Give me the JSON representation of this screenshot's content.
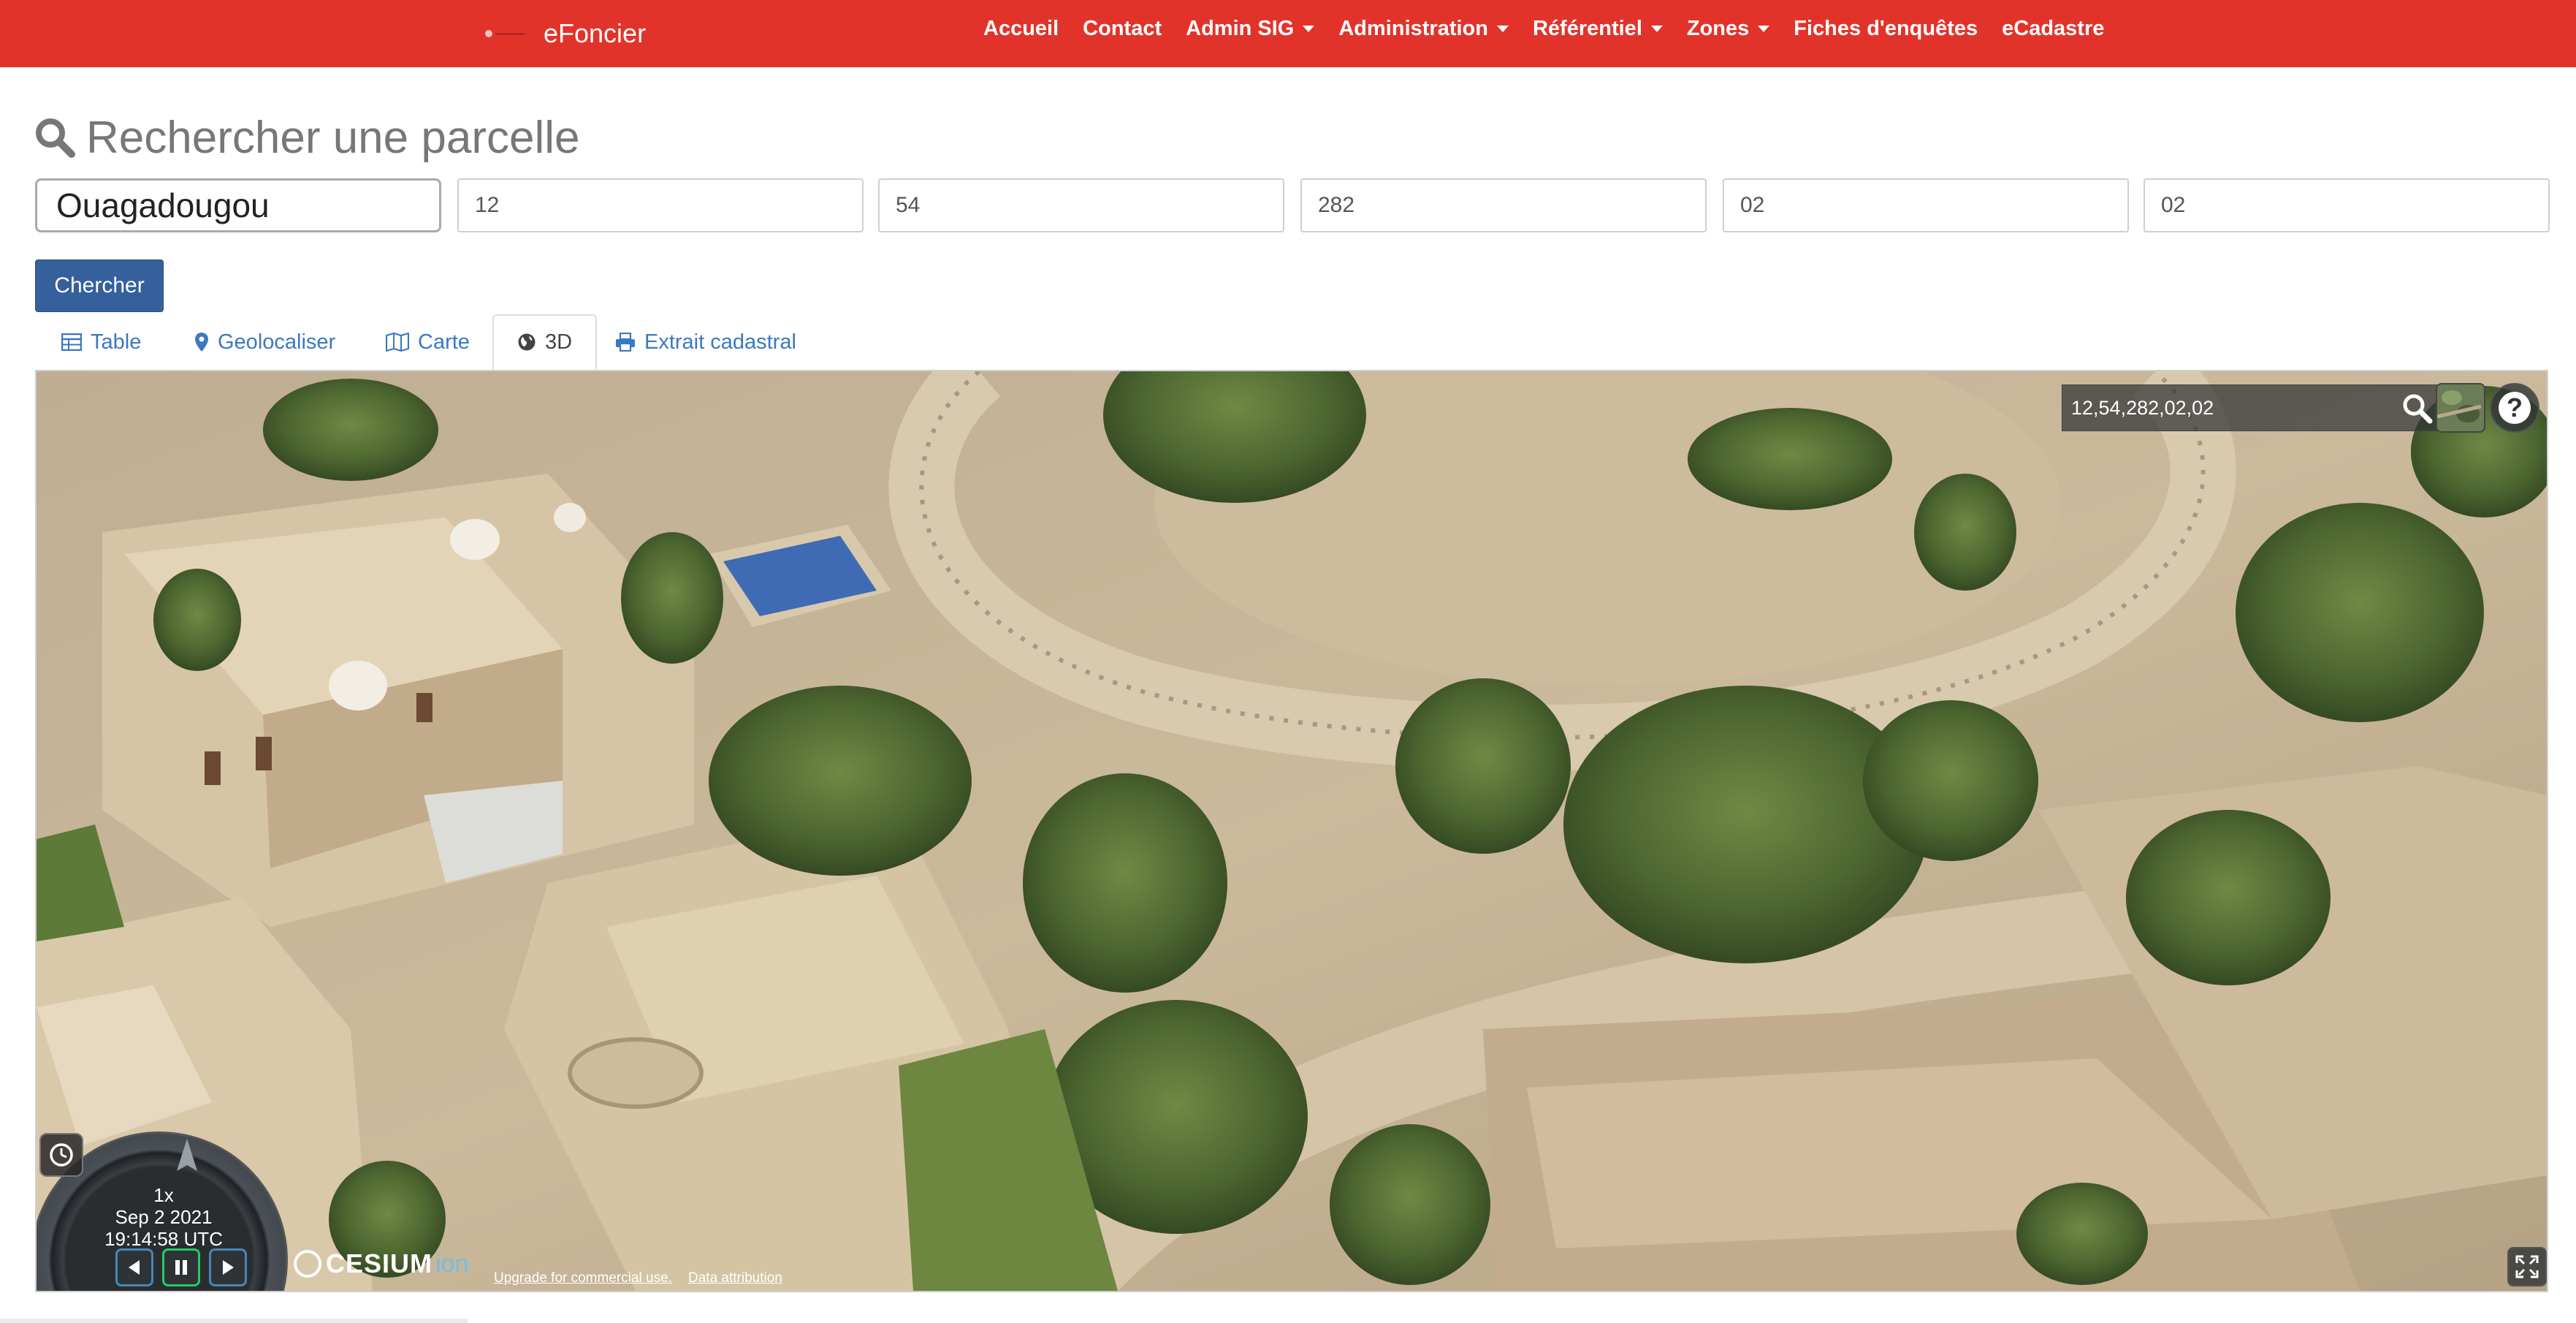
{
  "navbar": {
    "brand": "eFoncier",
    "items": [
      {
        "label": "Accueil",
        "dropdown": false
      },
      {
        "label": "Contact",
        "dropdown": false
      },
      {
        "label": "Admin SIG",
        "dropdown": true
      },
      {
        "label": "Administration",
        "dropdown": true
      },
      {
        "label": "Référentiel",
        "dropdown": true
      },
      {
        "label": "Zones",
        "dropdown": true
      },
      {
        "label": "Fiches d'enquêtes",
        "dropdown": false
      },
      {
        "label": "eCadastre",
        "dropdown": false
      }
    ],
    "color": "#e2332b"
  },
  "search": {
    "title": "Rechercher une parcelle",
    "fields": [
      "Ouagadougou",
      "12",
      "54",
      "282",
      "02",
      "02"
    ],
    "button_label": "Chercher",
    "button_color": "#35609b"
  },
  "tabs": [
    {
      "label": "Table",
      "icon": "table-icon",
      "active": false
    },
    {
      "label": "Geolocaliser",
      "icon": "map-marker-icon",
      "active": false
    },
    {
      "label": "Carte",
      "icon": "map-icon",
      "active": false
    },
    {
      "label": "3D",
      "icon": "globe-icon",
      "active": true
    },
    {
      "label": "Extrait cadastral",
      "icon": "print-icon",
      "active": false
    }
  ],
  "viewer": {
    "geocoder_value": "12,54,282,02,02",
    "help_label": "?",
    "animation": {
      "speed": "1x",
      "date": "Sep 2 2021",
      "time": "19:14:58 UTC"
    },
    "logo": {
      "word": "CESIUM",
      "suffix": "ion"
    },
    "credits": {
      "upgrade": "Upgrade for commercial use.",
      "attribution": "Data attribution"
    }
  }
}
